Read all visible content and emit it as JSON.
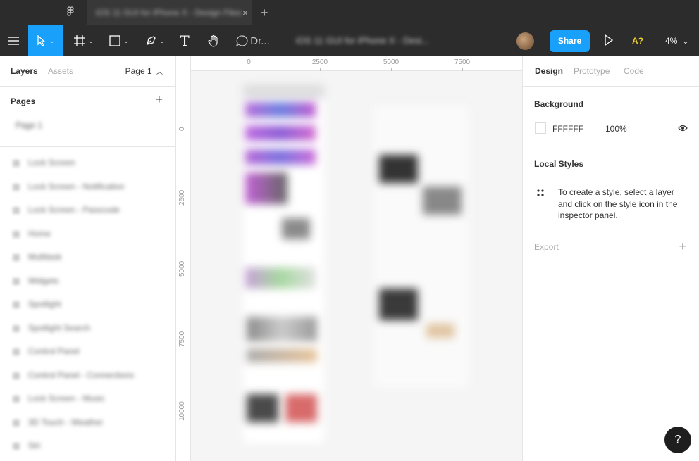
{
  "titlebar": {
    "tab_title": "iOS 11 GUI for iPhone X - Design Files",
    "close_glyph": "×",
    "add_glyph": "+"
  },
  "toolbar": {
    "menu_icon": "hamburger-icon",
    "move_tool_icon": "cursor-icon",
    "frame_tool_icon": "frame-icon",
    "shape_tool_icon": "rectangle-icon",
    "pen_tool_icon": "pen-icon",
    "text_tool_label": "T",
    "hand_tool_icon": "hand-icon",
    "comment_tool_label": "Dr...",
    "document_title": "iOS 11 GUI for iPhone X - Desi...",
    "share_label": "Share",
    "a11y_label": "A?",
    "zoom_label": "4%",
    "accent_color": "#18a0fb"
  },
  "left_panel": {
    "tabs": [
      "Layers",
      "Assets"
    ],
    "page_selector": "Page 1",
    "pages_title": "Pages",
    "pages": [
      "Page 1"
    ],
    "layers": [
      "Lock Screen",
      "Lock Screen - Notification",
      "Lock Screen - Passcode",
      "Home",
      "Multitask",
      "Widgets",
      "Spotlight",
      "Spotlight Search",
      "Control Panel",
      "Control Panel - Connections",
      "Lock Screen - Music",
      "3D Touch - Weather",
      "Siri"
    ]
  },
  "canvas": {
    "ruler_x": [
      "0",
      "2500",
      "5000",
      "7500"
    ],
    "ruler_y": [
      "0",
      "2500",
      "5000",
      "7500",
      "10000"
    ]
  },
  "right_panel": {
    "tabs": [
      "Design",
      "Prototype",
      "Code"
    ],
    "background_title": "Background",
    "background_hex": "FFFFFF",
    "background_opacity": "100%",
    "local_styles_title": "Local Styles",
    "local_styles_text": "To create a style, select a layer and click on the style icon in the inspector panel.",
    "export_title": "Export"
  },
  "help_label": "?"
}
